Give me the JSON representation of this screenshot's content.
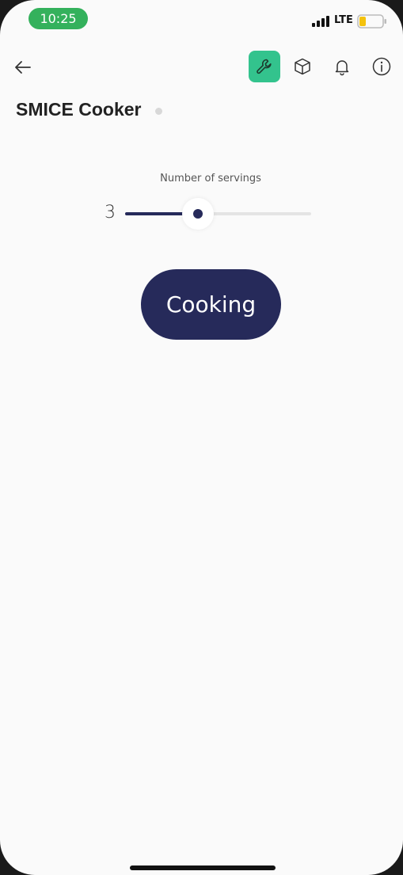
{
  "status_bar": {
    "time": "10:25",
    "network": "LTE",
    "battery_level": 0.3,
    "time_pill_color": "#34b15c",
    "battery_color": "#f4c20d"
  },
  "nav": {
    "back_icon": "arrow-left-icon",
    "active_tab_icon": "wrench-icon",
    "active_tab_color": "#33c38d",
    "tabs": [
      "wrench-icon",
      "cube-icon",
      "bell-icon",
      "info-icon"
    ]
  },
  "device": {
    "title": "SMICE Cooker",
    "status_dot_color": "#d8d8d8"
  },
  "servings": {
    "label": "Number of servings",
    "value": "3",
    "slider_fraction": 0.39
  },
  "action": {
    "label": "Cooking",
    "color": "#262a5a"
  }
}
